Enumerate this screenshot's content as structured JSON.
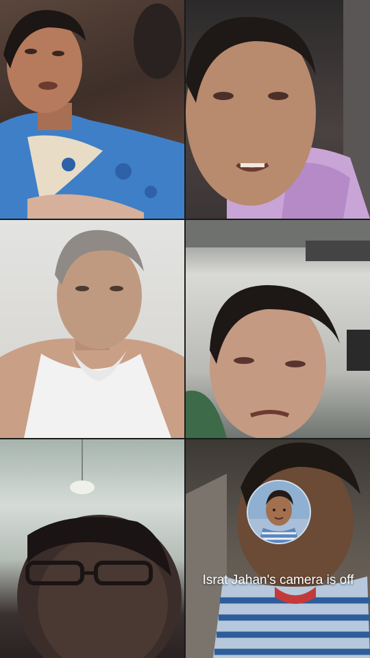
{
  "participants": [
    {
      "position": "top-left",
      "camera": "on"
    },
    {
      "position": "top-right",
      "camera": "on"
    },
    {
      "position": "middle-left",
      "camera": "on"
    },
    {
      "position": "middle-right",
      "camera": "on"
    },
    {
      "position": "bottom-left",
      "camera": "on"
    },
    {
      "position": "bottom-right",
      "camera": "off",
      "name": "Israt Jahan"
    }
  ],
  "overlay": {
    "message": "Israt Jahan's camera is off",
    "avatar_icon": "profile-avatar"
  },
  "colors": {
    "divider": "#1a1a1a",
    "overlay_text": "#ffffff"
  }
}
